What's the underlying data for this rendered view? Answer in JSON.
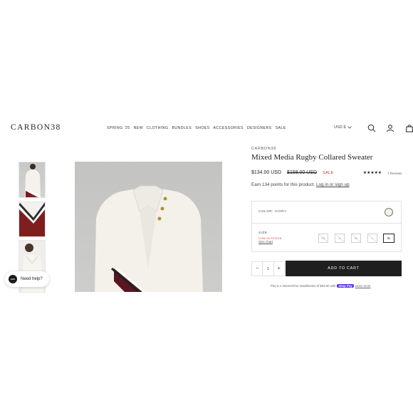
{
  "header": {
    "logo": "CARBON38",
    "nav": [
      "SPRING '25",
      "NEW",
      "CLOTHING",
      "BUNDLES",
      "SHOES",
      "ACCESSORIES",
      "DESIGNERS",
      "SALE"
    ],
    "currency": "USD $",
    "icons": [
      "search-icon",
      "account-icon",
      "bag-icon"
    ]
  },
  "product": {
    "brand": "CARBON38",
    "title": "Mixed Media Rugby Collared Sweater",
    "price": "$134.00 USD",
    "compare_price": "$158.00 USD",
    "sale_label": "SALE",
    "stars": "★★★★★",
    "rating": 5,
    "reviews": "7 Reviews",
    "earn": {
      "text": "Earn 134 points for this product.",
      "link": "Log in or sign up"
    },
    "color": {
      "label": "COLOR: IVORY",
      "swatch": "#f5f1e6"
    },
    "size": {
      "label": "SIZE",
      "stock": "LOW IN STOCK",
      "chart_link": "Size chart",
      "options": [
        "XS",
        "S",
        "M",
        "L",
        "XL"
      ],
      "selected": "XL"
    },
    "quantity": {
      "minus": "−",
      "value": "1",
      "plus": "+"
    },
    "add_to_cart": "ADD TO CART",
    "installments": {
      "text": "Pay in 4 interest-free installments of $33.50 with",
      "brand": "shop Pay",
      "learn": "Learn more"
    }
  },
  "gallery": {
    "thumbnail_count": 3
  },
  "chat": {
    "label": "Need help?"
  },
  "colors": {
    "sale_red": "#c0392b",
    "cart_button": "#1f1f1f",
    "shop_pay": "#5a31f4"
  }
}
